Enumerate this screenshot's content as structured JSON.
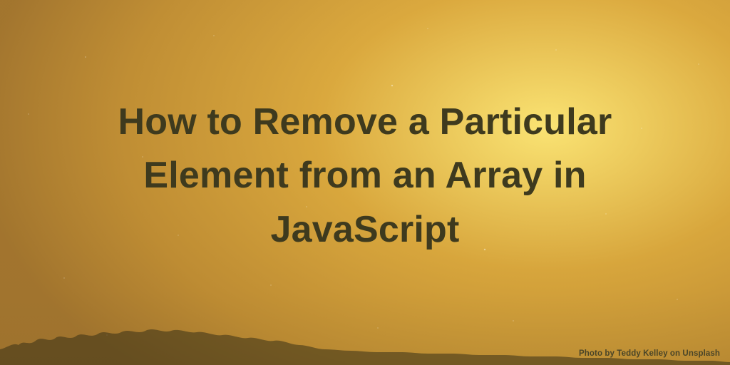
{
  "headline": "How to Remove a Particular Element from an Array in JavaScript",
  "credit": "Photo by Teddy Kelley on Unsplash"
}
